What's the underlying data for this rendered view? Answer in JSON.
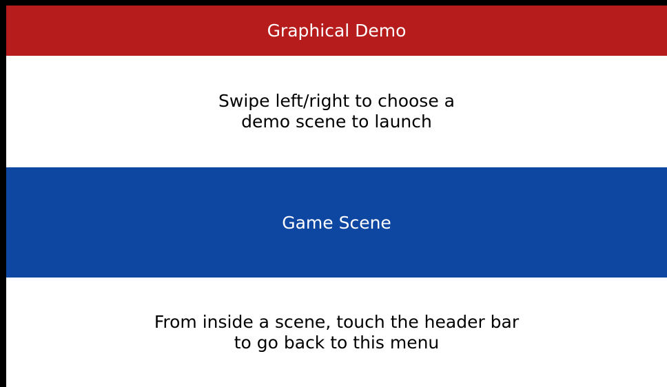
{
  "colors": {
    "header_bg": "#b71c1c",
    "carousel_bg": "#0d47a1",
    "screen_bg": "#ffffff",
    "border": "#000000"
  },
  "header": {
    "title": "Graphical Demo"
  },
  "instruction": {
    "line1": "Swipe left/right to choose a",
    "line2": "demo scene to launch"
  },
  "carousel": {
    "selected_scene": "Game Scene"
  },
  "footer": {
    "line1": "From inside a scene, touch the header bar",
    "line2": "to go back to this menu"
  }
}
